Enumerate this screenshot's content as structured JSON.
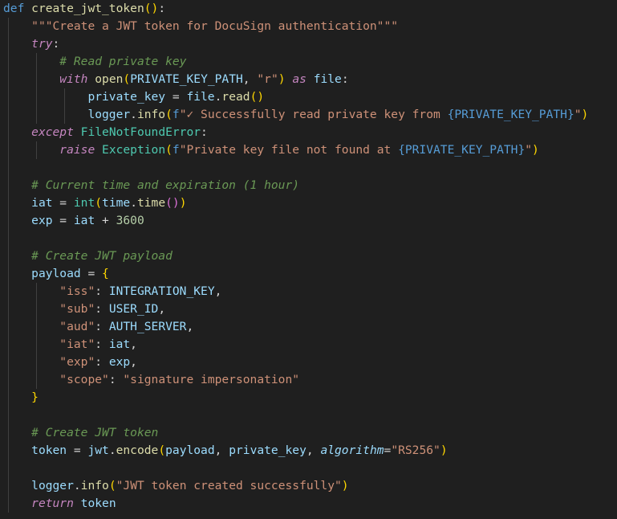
{
  "editor": {
    "language": "python",
    "colors": {
      "background": "#1f1f1f",
      "keyword": "#569cd6",
      "control": "#c586c0",
      "function": "#dcdcaa",
      "string": "#ce9178",
      "number": "#b5cea8",
      "variable": "#9cdcfe",
      "class": "#4ec9b0",
      "comment": "#6a9955",
      "bracket_level1": "#ffd700",
      "bracket_level2": "#da70d6",
      "bracket_level3": "#179fff"
    }
  },
  "code": {
    "l1": {
      "def": "def",
      "name": "create_jwt_token",
      "open": "(",
      "close": ")",
      "colon": ":"
    },
    "l2": {
      "doc": "\"\"\"Create a JWT token for DocuSign authentication\"\"\""
    },
    "l3": {
      "try": "try",
      "colon": ":"
    },
    "l4": {
      "comment": "# Read private key"
    },
    "l5": {
      "with": "with",
      "open_fn": "open",
      "p_open": "(",
      "arg": "PRIVATE_KEY_PATH",
      "comma": ", ",
      "mode": "\"r\"",
      "p_close": ")",
      "as": "as",
      "file": "file",
      "colon": ":"
    },
    "l6": {
      "var": "private_key",
      "eq": " = ",
      "obj": "file",
      "dot": ".",
      "method": "read",
      "parens": "()"
    },
    "l7": {
      "obj": "logger",
      "dot": ".",
      "method": "info",
      "p_open": "(",
      "f": "f",
      "str1": "\"✓ Successfully read private key from ",
      "interp": "{PRIVATE_KEY_PATH}",
      "str2": "\"",
      "p_close": ")"
    },
    "l8": {
      "except": "except",
      "cls": "FileNotFoundError",
      "colon": ":"
    },
    "l9": {
      "raise": "raise",
      "cls": "Exception",
      "p_open": "(",
      "f": "f",
      "str1": "\"Private key file not found at ",
      "interp": "{PRIVATE_KEY_PATH}",
      "str2": "\"",
      "p_close": ")"
    },
    "l11": {
      "comment": "# Current time and expiration (1 hour)"
    },
    "l12": {
      "var": "iat",
      "eq": " = ",
      "int": "int",
      "p1": "(",
      "time": "time",
      "dot": ".",
      "method": "time",
      "p2": "()",
      "p3": ")"
    },
    "l13": {
      "var": "exp",
      "eq": " = ",
      "iat": "iat",
      "plus": " + ",
      "num": "3600"
    },
    "l15": {
      "comment": "# Create JWT payload"
    },
    "l16": {
      "var": "payload",
      "eq": " = ",
      "brace": "{"
    },
    "payload_items": [
      {
        "key": "\"iss\"",
        "sep": ": ",
        "val": "INTEGRATION_KEY",
        "tail": ",",
        "val_type": "var"
      },
      {
        "key": "\"sub\"",
        "sep": ": ",
        "val": "USER_ID",
        "tail": ",",
        "val_type": "var"
      },
      {
        "key": "\"aud\"",
        "sep": ": ",
        "val": "AUTH_SERVER",
        "tail": ",",
        "val_type": "var"
      },
      {
        "key": "\"iat\"",
        "sep": ": ",
        "val": "iat",
        "tail": ",",
        "val_type": "var"
      },
      {
        "key": "\"exp\"",
        "sep": ": ",
        "val": "exp",
        "tail": ",",
        "val_type": "var"
      },
      {
        "key": "\"scope\"",
        "sep": ": ",
        "val": "\"signature impersonation\"",
        "tail": "",
        "val_type": "str"
      }
    ],
    "l23": {
      "brace": "}"
    },
    "l25": {
      "comment": "# Create JWT token"
    },
    "l26": {
      "var": "token",
      "eq": " = ",
      "obj": "jwt",
      "dot": ".",
      "method": "encode",
      "p_open": "(",
      "a1": "payload",
      "c1": ", ",
      "a2": "private_key",
      "c2": ", ",
      "kw": "algorithm",
      "kweq": "=",
      "val": "\"RS256\"",
      "p_close": ")"
    },
    "l28": {
      "obj": "logger",
      "dot": ".",
      "method": "info",
      "p_open": "(",
      "str": "\"JWT token created successfully\"",
      "p_close": ")"
    },
    "l29": {
      "ret": "return",
      "val": "token"
    }
  }
}
